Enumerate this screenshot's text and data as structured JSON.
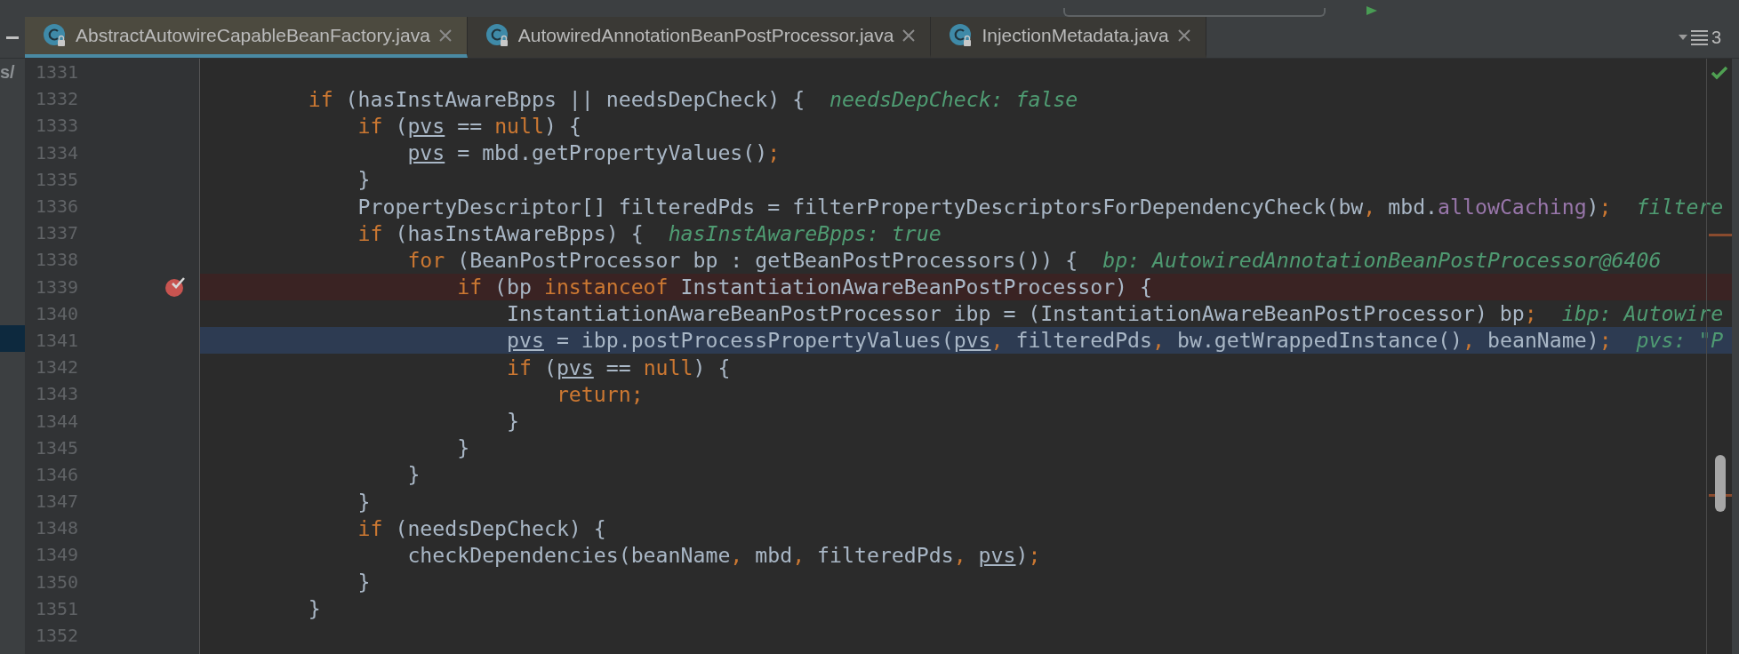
{
  "project_panel": {
    "path_fragment": "s/"
  },
  "tabs": [
    {
      "label": "AbstractAutowireCapableBeanFactory.java",
      "selected": true
    },
    {
      "label": "AutowiredAnnotationBeanPostProcessor.java",
      "selected": false
    },
    {
      "label": "InjectionMetadata.java",
      "selected": false
    }
  ],
  "tab_overflow": {
    "count": "3"
  },
  "editor": {
    "lines": [
      {
        "number": "1331",
        "breakpoint": false,
        "current": false
      },
      {
        "number": "1332",
        "breakpoint": false,
        "current": false,
        "tokens": [
          {
            "kind": "kw",
            "text": "        if"
          },
          {
            "kind": "plain",
            "text": " (hasInstAwareBpps || needsDepCheck) {"
          }
        ],
        "value_hint": "needsDepCheck: false"
      },
      {
        "number": "1333",
        "breakpoint": false,
        "current": false,
        "tokens": [
          {
            "kind": "kw",
            "text": "            if"
          },
          {
            "kind": "plain",
            "text": " ("
          },
          {
            "kind": "var",
            "text": "pvs"
          },
          {
            "kind": "plain",
            "text": " == "
          },
          {
            "kind": "kw",
            "text": "null"
          },
          {
            "kind": "plain",
            "text": ") {"
          }
        ]
      },
      {
        "number": "1334",
        "breakpoint": false,
        "current": false,
        "tokens": [
          {
            "kind": "var",
            "text": "                pvs"
          },
          {
            "kind": "plain",
            "text": " = mbd.getPropertyValues()"
          },
          {
            "kind": "punct",
            "text": ";"
          }
        ]
      },
      {
        "number": "1335",
        "breakpoint": false,
        "current": false,
        "tokens": [
          {
            "kind": "plain",
            "text": "            }"
          }
        ]
      },
      {
        "number": "1336",
        "breakpoint": false,
        "current": false,
        "tokens": [
          {
            "kind": "plain",
            "text": "            PropertyDescriptor[] filteredPds = filterPropertyDescriptorsForDependencyCheck(bw"
          },
          {
            "kind": "punct",
            "text": ","
          },
          {
            "kind": "plain",
            "text": " mbd."
          },
          {
            "kind": "field",
            "text": "allowCaching"
          },
          {
            "kind": "plain",
            "text": ")"
          },
          {
            "kind": "punct",
            "text": ";"
          }
        ],
        "value_hint": "filtere"
      },
      {
        "number": "1337",
        "breakpoint": false,
        "current": false,
        "tokens": [
          {
            "kind": "kw",
            "text": "            if"
          },
          {
            "kind": "plain",
            "text": " (hasInstAwareBpps) {"
          }
        ],
        "value_hint": "hasInstAwareBpps: true"
      },
      {
        "number": "1338",
        "breakpoint": false,
        "current": false,
        "tokens": [
          {
            "kind": "kw",
            "text": "                for"
          },
          {
            "kind": "plain",
            "text": " (BeanPostProcessor bp : getBeanPostProcessors()) {"
          }
        ],
        "value_hint": "bp: AutowiredAnnotationBeanPostProcessor@6406"
      },
      {
        "number": "1339",
        "breakpoint": true,
        "current": false,
        "tokens": [
          {
            "kind": "kw",
            "text": "                    if"
          },
          {
            "kind": "plain",
            "text": " (bp "
          },
          {
            "kind": "kw",
            "text": "instanceof"
          },
          {
            "kind": "plain",
            "text": " InstantiationAwareBeanPostProcessor) {"
          }
        ]
      },
      {
        "number": "1340",
        "breakpoint": false,
        "current": false,
        "tokens": [
          {
            "kind": "plain",
            "text": "                        InstantiationAwareBeanPostProcessor ibp = (InstantiationAwareBeanPostProcessor) bp"
          },
          {
            "kind": "punct",
            "text": ";"
          }
        ],
        "value_hint": "ibp: Autowire"
      },
      {
        "number": "1341",
        "breakpoint": false,
        "current": true,
        "tokens": [
          {
            "kind": "var",
            "text": "                        pvs"
          },
          {
            "kind": "plain",
            "text": " = ibp.postProcessPropertyValues("
          },
          {
            "kind": "var",
            "text": "pvs"
          },
          {
            "kind": "punct",
            "text": ","
          },
          {
            "kind": "plain",
            "text": " filteredPds"
          },
          {
            "kind": "punct",
            "text": ","
          },
          {
            "kind": "plain",
            "text": " bw.getWrappedInstance()"
          },
          {
            "kind": "punct",
            "text": ","
          },
          {
            "kind": "plain",
            "text": " beanName)"
          },
          {
            "kind": "punct",
            "text": ";"
          }
        ],
        "value_hint": "pvs: \"P"
      },
      {
        "number": "1342",
        "breakpoint": false,
        "current": false,
        "tokens": [
          {
            "kind": "kw",
            "text": "                        if"
          },
          {
            "kind": "plain",
            "text": " ("
          },
          {
            "kind": "var",
            "text": "pvs"
          },
          {
            "kind": "plain",
            "text": " == "
          },
          {
            "kind": "kw",
            "text": "null"
          },
          {
            "kind": "plain",
            "text": ") {"
          }
        ]
      },
      {
        "number": "1343",
        "breakpoint": false,
        "current": false,
        "tokens": [
          {
            "kind": "kw",
            "text": "                            return"
          },
          {
            "kind": "punct",
            "text": ";"
          }
        ]
      },
      {
        "number": "1344",
        "breakpoint": false,
        "current": false,
        "tokens": [
          {
            "kind": "plain",
            "text": "                        }"
          }
        ]
      },
      {
        "number": "1345",
        "breakpoint": false,
        "current": false,
        "tokens": [
          {
            "kind": "plain",
            "text": "                    }"
          }
        ]
      },
      {
        "number": "1346",
        "breakpoint": false,
        "current": false,
        "tokens": [
          {
            "kind": "plain",
            "text": "                }"
          }
        ]
      },
      {
        "number": "1347",
        "breakpoint": false,
        "current": false,
        "tokens": [
          {
            "kind": "plain",
            "text": "            }"
          }
        ]
      },
      {
        "number": "1348",
        "breakpoint": false,
        "current": false,
        "tokens": [
          {
            "kind": "kw",
            "text": "            if"
          },
          {
            "kind": "plain",
            "text": " (needsDepCheck) {"
          }
        ]
      },
      {
        "number": "1349",
        "breakpoint": false,
        "current": false,
        "tokens": [
          {
            "kind": "plain",
            "text": "                checkDependencies(beanName"
          },
          {
            "kind": "punct",
            "text": ","
          },
          {
            "kind": "plain",
            "text": " mbd"
          },
          {
            "kind": "punct",
            "text": ","
          },
          {
            "kind": "plain",
            "text": " filteredPds"
          },
          {
            "kind": "punct",
            "text": ","
          },
          {
            "kind": "var",
            "text": " pvs"
          },
          {
            "kind": "plain",
            "text": ")"
          },
          {
            "kind": "punct",
            "text": ";"
          }
        ]
      },
      {
        "number": "1350",
        "breakpoint": false,
        "current": false,
        "tokens": [
          {
            "kind": "plain",
            "text": "            }"
          }
        ]
      },
      {
        "number": "1351",
        "breakpoint": false,
        "current": false,
        "tokens": [
          {
            "kind": "plain",
            "text": "        }"
          }
        ]
      },
      {
        "number": "1352",
        "breakpoint": false,
        "current": false
      }
    ]
  }
}
